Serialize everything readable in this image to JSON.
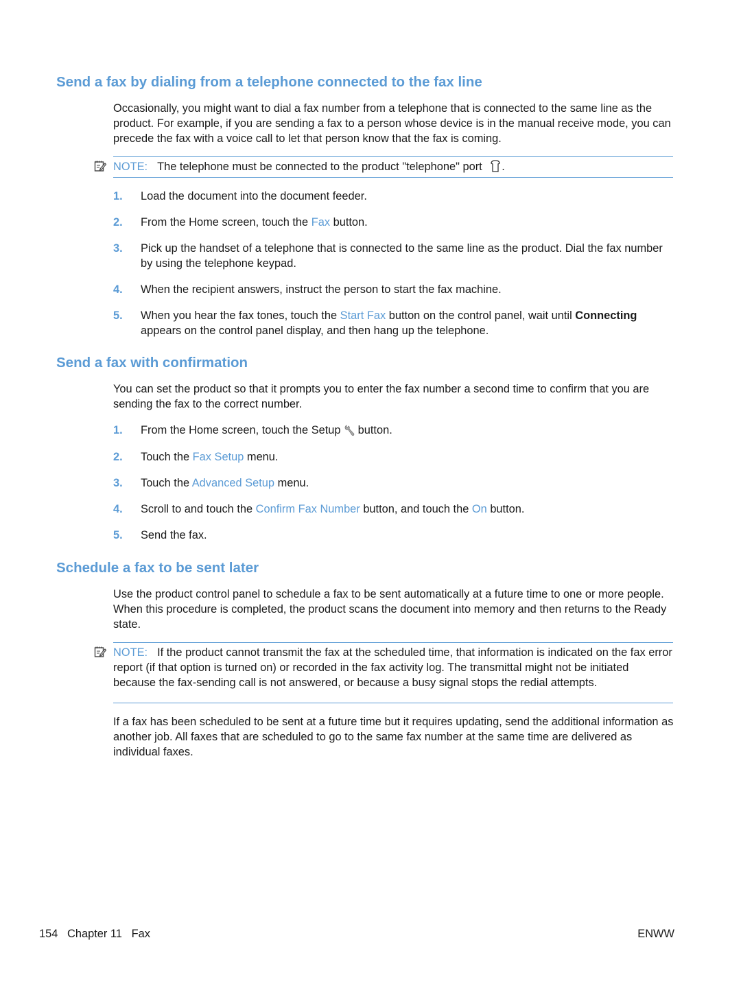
{
  "sections": [
    {
      "heading": "Send a fax by dialing from a telephone connected to the fax line",
      "intro": "Occasionally, you might want to dial a fax number from a telephone that is connected to the same line as the product. For example, if you are sending a fax to a person whose device is in the manual receive mode, you can precede the fax with a voice call to let that person know that the fax is coming.",
      "note": {
        "label": "NOTE:",
        "text": "The telephone must be connected to the product \"telephone\" port",
        "trailing": ".",
        "icon": "telephone-port-icon"
      },
      "steps": [
        {
          "num": "1.",
          "parts": [
            {
              "t": "Load the document into the document feeder."
            }
          ]
        },
        {
          "num": "2.",
          "parts": [
            {
              "t": "From the Home screen, touch the "
            },
            {
              "t": "Fax",
              "link": true
            },
            {
              "t": " button."
            }
          ]
        },
        {
          "num": "3.",
          "parts": [
            {
              "t": "Pick up the handset of a telephone that is connected to the same line as the product. Dial the fax number by using the telephone keypad."
            }
          ]
        },
        {
          "num": "4.",
          "parts": [
            {
              "t": "When the recipient answers, instruct the person to start the fax machine."
            }
          ]
        },
        {
          "num": "5.",
          "parts": [
            {
              "t": "When you hear the fax tones, touch the "
            },
            {
              "t": "Start Fax",
              "link": true
            },
            {
              "t": " button on the control panel, wait until "
            },
            {
              "t": "Connecting",
              "bold": true
            },
            {
              "t": " appears on the control panel display, and then hang up the telephone."
            }
          ]
        }
      ]
    },
    {
      "heading": "Send a fax with confirmation",
      "intro": "You can set the product so that it prompts you to enter the fax number a second time to confirm that you are sending the fax to the correct number.",
      "steps": [
        {
          "num": "1.",
          "parts": [
            {
              "t": "From the Home screen, touch the Setup "
            },
            {
              "icon": "wrench-icon"
            },
            {
              "t": " button."
            }
          ]
        },
        {
          "num": "2.",
          "parts": [
            {
              "t": "Touch the "
            },
            {
              "t": "Fax Setup",
              "link": true
            },
            {
              "t": " menu."
            }
          ]
        },
        {
          "num": "3.",
          "parts": [
            {
              "t": "Touch the "
            },
            {
              "t": "Advanced Setup",
              "link": true
            },
            {
              "t": " menu."
            }
          ]
        },
        {
          "num": "4.",
          "parts": [
            {
              "t": "Scroll to and touch the "
            },
            {
              "t": "Confirm Fax Number",
              "link": true
            },
            {
              "t": " button, and touch the "
            },
            {
              "t": "On",
              "link": true
            },
            {
              "t": " button."
            }
          ]
        },
        {
          "num": "5.",
          "parts": [
            {
              "t": "Send the fax."
            }
          ]
        }
      ]
    },
    {
      "heading": "Schedule a fax to be sent later",
      "intro": "Use the product control panel to schedule a fax to be sent automatically at a future time to one or more people. When this procedure is completed, the product scans the document into memory and then returns to the Ready state.",
      "note": {
        "label": "NOTE:",
        "text": "If the product cannot transmit the fax at the scheduled time, that information is indicated on the fax error report (if that option is turned on) or recorded in the fax activity log. The transmittal might not be initiated because the fax-sending call is not answered, or because a busy signal stops the redial attempts."
      },
      "outro": "If a fax has been scheduled to be sent at a future time but it requires updating, send the additional information as another job. All faxes that are scheduled to go to the same fax number at the same time are delivered as individual faxes."
    }
  ],
  "footer": {
    "page_number": "154",
    "chapter": "Chapter 11",
    "chapter_title": "Fax",
    "locale": "ENWW"
  },
  "colors": {
    "accent": "#5b9bd5",
    "text": "#1a1a1a"
  }
}
